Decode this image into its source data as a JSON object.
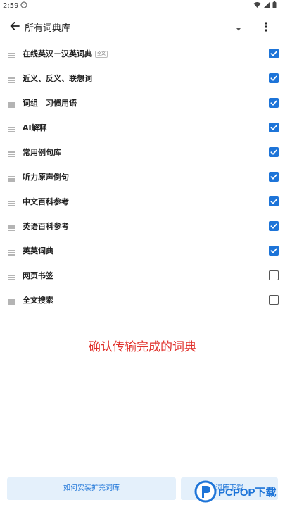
{
  "status": {
    "time": "2:59"
  },
  "header": {
    "title": "所有词典库"
  },
  "colors": {
    "accent": "#1d74d8",
    "message": "#e0312b",
    "button_bg": "#e4f0fb"
  },
  "dictionaries": [
    {
      "label": "在线英汉－汉英词典",
      "badge": "全文",
      "checked": true
    },
    {
      "label": "近义、反义、联想词",
      "checked": true
    },
    {
      "label": "词组｜习惯用语",
      "checked": true
    },
    {
      "label": "AI解释",
      "checked": true
    },
    {
      "label": "常用例句库",
      "checked": true
    },
    {
      "label": "听力原声例句",
      "checked": true
    },
    {
      "label": "中文百科参考",
      "checked": true
    },
    {
      "label": "英语百科参考",
      "checked": true
    },
    {
      "label": "英英词典",
      "checked": true
    },
    {
      "label": "网页书签",
      "checked": false
    },
    {
      "label": "全文搜索",
      "checked": false
    }
  ],
  "message": "确认传输完成的词典",
  "bottom": {
    "install_label": "如何安装扩充词库",
    "download_label": "词库下载"
  },
  "watermark": {
    "text": "PCPOP下载"
  }
}
